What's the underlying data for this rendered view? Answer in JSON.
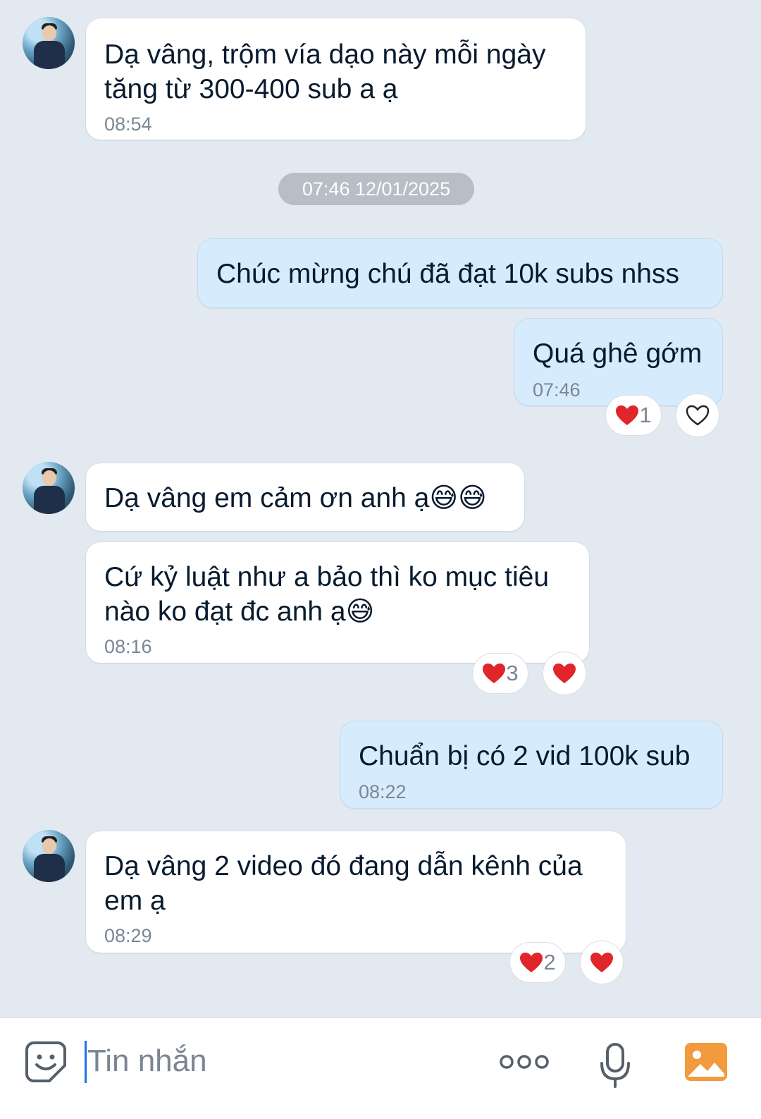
{
  "messages": [
    {
      "text": "Dạ vâng, trộm vía dạo này mỗi ngày\ntăng từ 300-400 sub a ạ",
      "time": "08:54"
    },
    {
      "text": "Chúc mừng chú đã đạt 10k subs nhss"
    },
    {
      "text": "Quá ghê gớm",
      "time": "07:46",
      "reaction_count": "1"
    },
    {
      "text": "Dạ vâng em cảm ơn anh ạ😅😅"
    },
    {
      "text": "Cứ kỷ luật như a bảo thì ko mục tiêu\nnào ko đạt đc anh ạ😅",
      "time": "08:16",
      "reaction_count": "3"
    },
    {
      "text": "Chuẩn bị có 2 vid 100k sub",
      "time": "08:22"
    },
    {
      "text": "Dạ vâng 2 video đó đang dẫn kênh của\nem ạ",
      "time": "08:29",
      "reaction_count": "2"
    }
  ],
  "date_separator": "07:46 12/01/2025",
  "composer": {
    "placeholder": "Tin nhắn"
  },
  "icons": {
    "emoji": "sticker-face-icon",
    "more": "more-dots-icon",
    "mic": "microphone-icon",
    "gallery": "image-gallery-icon",
    "heart": "heart-icon"
  },
  "colors": {
    "background": "#e2e9f1",
    "sent_bubble": "#d6ecfd",
    "received_bubble": "#ffffff",
    "heart": "#e0262b",
    "gallery_icon": "#f29a3d"
  }
}
